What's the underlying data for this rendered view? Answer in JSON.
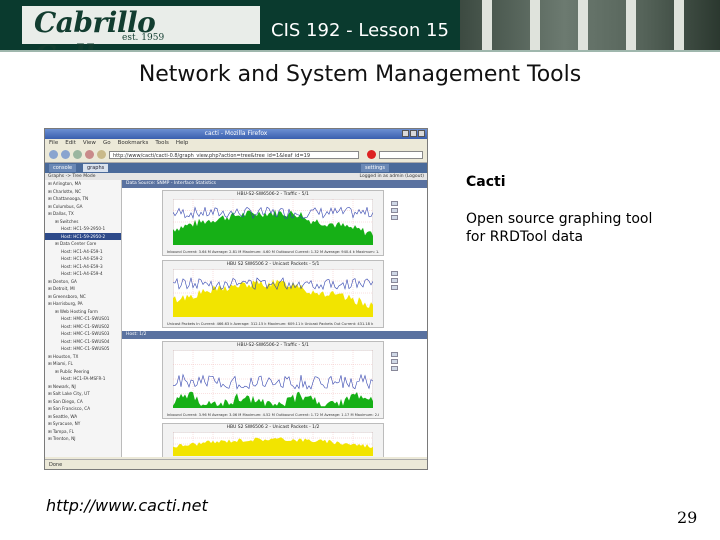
{
  "slide": {
    "logo_text": "Cabrillo College",
    "logo_est": "est. 1959",
    "lesson": "CIS 192 - Lesson 15",
    "title": "Network and System Management Tools",
    "right_heading": "Cacti",
    "right_desc": "Open source graphing tool for RRDTool data",
    "link": "http://www.cacti.net",
    "page_number": "29"
  },
  "browser": {
    "window_title": "cacti - Mozilla Firefox",
    "menu": [
      "File",
      "Edit",
      "View",
      "Go",
      "Bookmarks",
      "Tools",
      "Help"
    ],
    "url": "http://www/cacti/cacti-0.8/graph_view.php?action=tree&tree_id=1&leaf_id=19",
    "status": "Done"
  },
  "cacti": {
    "tab_console": "console",
    "tab_graphs": "graphs",
    "tab_settings": "settings",
    "logged_in": "Logged in as admin (Logout)",
    "breadcrumb": "Graphs -> Tree Mode",
    "section1": "Data Source: SNMP - Interface Statistics",
    "section2": "Host: 1/2",
    "tree_items": [
      "Arlington, MA",
      "Charlotte, NC",
      "Chattanooga, TN",
      "Columbus, GA",
      "Dallas, TX",
      "Switches",
      "Host: HC1-59-2950-1",
      "Host: HC1-59-2950-2",
      "Data Center Core",
      "Host: HC1-A4-E59-1",
      "Host: HC1-A4-E59-2",
      "Host: HC1-A4-E59-3",
      "Host: HC1-A4-E59-4",
      "Denton, GA",
      "Detroit, MI",
      "Greensboro, NC",
      "Harrisburg, PA",
      "Web Hosting Farm",
      "Host: HMC-C1-SWUS01",
      "Host: HMC-C1-SWUS02",
      "Host: HMC-C1-SWUS03",
      "Host: HMC-C1-SWUS04",
      "Host: HMC-C1-SWUS05",
      "Houston, TX",
      "Miami, FL",
      "Public Peering",
      "Host: HC1-FA-MSFR-1",
      "Newark, NJ",
      "Salt Lake City, UT",
      "San Diego, CA",
      "San Francisco, CA",
      "Seattle, WA",
      "Syracuse, NY",
      "Tampa, FL",
      "Trenton, NJ"
    ],
    "graphs": [
      {
        "name": "HBU-S2-SW6506-2 - Traffic - 5/1",
        "legend": "Inbound  Current: 3.64 M  Average: 2.81 M  Maximum: 4.60 M   Outbound  Current: 1.32 M  Average: 940.4 k  Maximum: 1.99 M"
      },
      {
        "name": "HBU S2 SW6506 2 - Unicast Packets - 5/1",
        "legend": "Unicast Packets In  Current: 466.63 k  Average: 312.15 k  Maximum: 609.11 k   Unicast Packets Out  Current: 431.18 k"
      },
      {
        "name": "HBU-S2-SW6506-2 - Traffic - 5/1",
        "legend": "Inbound  Current: 3.96 M  Average: 3.06 M  Maximum: 4.52 M   Outbound  Current: 1.72 M  Average: 1.17 M  Maximum: 2.84 M"
      },
      {
        "name": "HBU S2 SW6506 2 - Unicast Packets - 1/2",
        "legend": ""
      }
    ]
  },
  "colors": {
    "header_bg": "#0a3a2e",
    "graph_green": "#16b016",
    "graph_yellow": "#f2e400",
    "graph_blue": "#3446b0"
  }
}
